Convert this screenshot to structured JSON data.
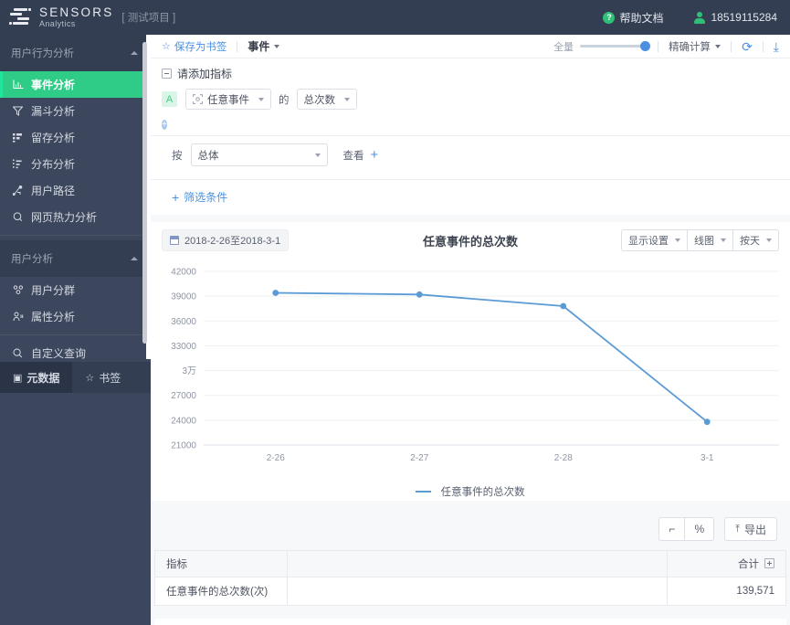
{
  "header": {
    "brand_name": "SENSORS",
    "brand_sub": "Analytics",
    "project_tag": "[ 测试项目 ]",
    "help_label": "帮助文档",
    "help_icon": "question-circle-icon",
    "user_icon": "user-icon",
    "user_phone": "18519115284"
  },
  "sidebar": {
    "groups": [
      {
        "title": "用户行为分析",
        "items": [
          {
            "label": "事件分析",
            "icon": "bar-chart-icon",
            "active": true
          },
          {
            "label": "漏斗分析",
            "icon": "funnel-icon",
            "active": false
          },
          {
            "label": "留存分析",
            "icon": "retention-icon",
            "active": false
          },
          {
            "label": "分布分析",
            "icon": "distribution-icon",
            "active": false
          },
          {
            "label": "用户路径",
            "icon": "path-icon",
            "active": false
          },
          {
            "label": "网页热力分析",
            "icon": "heatmap-icon",
            "active": false
          }
        ]
      },
      {
        "title": "用户分析",
        "items": [
          {
            "label": "用户分群",
            "icon": "users-group-icon",
            "active": false
          },
          {
            "label": "属性分析",
            "icon": "user-attr-icon",
            "active": false
          }
        ]
      }
    ],
    "standalone": {
      "label": "自定义查询",
      "icon": "search-query-icon"
    },
    "bottom": [
      {
        "label": "元数据",
        "icon": "metadata-icon",
        "active": true
      },
      {
        "label": "书签",
        "icon": "star-icon",
        "active": false
      }
    ]
  },
  "toolbar": {
    "save_bookmark": "保存为书签",
    "star_icon": "star-icon",
    "event_dropdown": "事件",
    "volume_label": "全量",
    "calc_mode": "精确计算",
    "refresh_icon": "refresh-icon",
    "download_icon": "download-icon"
  },
  "query": {
    "metric_head": "请添加指标",
    "collapse_icon": "minus-square-icon",
    "badge": "A",
    "event_icon": "target-icon",
    "event_value": "任意事件",
    "mid_word": "的",
    "measure_value": "总次数",
    "add_icon": "plus-circle-icon",
    "group_by_label": "按",
    "group_by_value": "总体",
    "view_label": "查看",
    "view_add_icon": "plus-icon",
    "filter_label": "筛选条件",
    "filter_add_icon": "plus-icon"
  },
  "chart": {
    "date_range": "2018-2-26至2018-3-1",
    "calendar_icon": "calendar-icon",
    "title": "任意事件的总次数",
    "controls": [
      {
        "label": "显示设置",
        "caret": true
      },
      {
        "label": "线图",
        "caret": true
      },
      {
        "label": "按天",
        "caret": true
      }
    ],
    "legend_label": "任意事件的总次数",
    "line_color": "#5b9bd5"
  },
  "chart_data": {
    "type": "line",
    "title": "任意事件的总次数",
    "xlabel": "",
    "ylabel": "",
    "categories": [
      "2-26",
      "2-27",
      "2-28",
      "3-1"
    ],
    "series": [
      {
        "name": "任意事件的总次数",
        "values": [
          39400,
          39200,
          37800,
          23800
        ],
        "color": "#5b9bd5"
      }
    ],
    "ylim": [
      21000,
      42000
    ],
    "ytick_values": [
      42000,
      39000,
      36000,
      33000,
      30000,
      27000,
      24000,
      21000
    ],
    "ytick_labels": [
      "42000",
      "39000",
      "36000",
      "33000",
      "3万",
      "27000",
      "24000",
      "21000"
    ],
    "grid": true,
    "legend_position": "bottom",
    "markers": true
  },
  "export": {
    "chart_toggle_icon": "curve-icon",
    "percent_label": "%",
    "export_label": "导出",
    "export_icon": "upload-icon"
  },
  "table": {
    "columns": [
      "指标",
      "",
      "合计"
    ],
    "total_expand_icon": "plus-square-icon",
    "rows": [
      {
        "metric": "任意事件的总次数(次)",
        "blank": "",
        "total": "139,571"
      }
    ]
  }
}
